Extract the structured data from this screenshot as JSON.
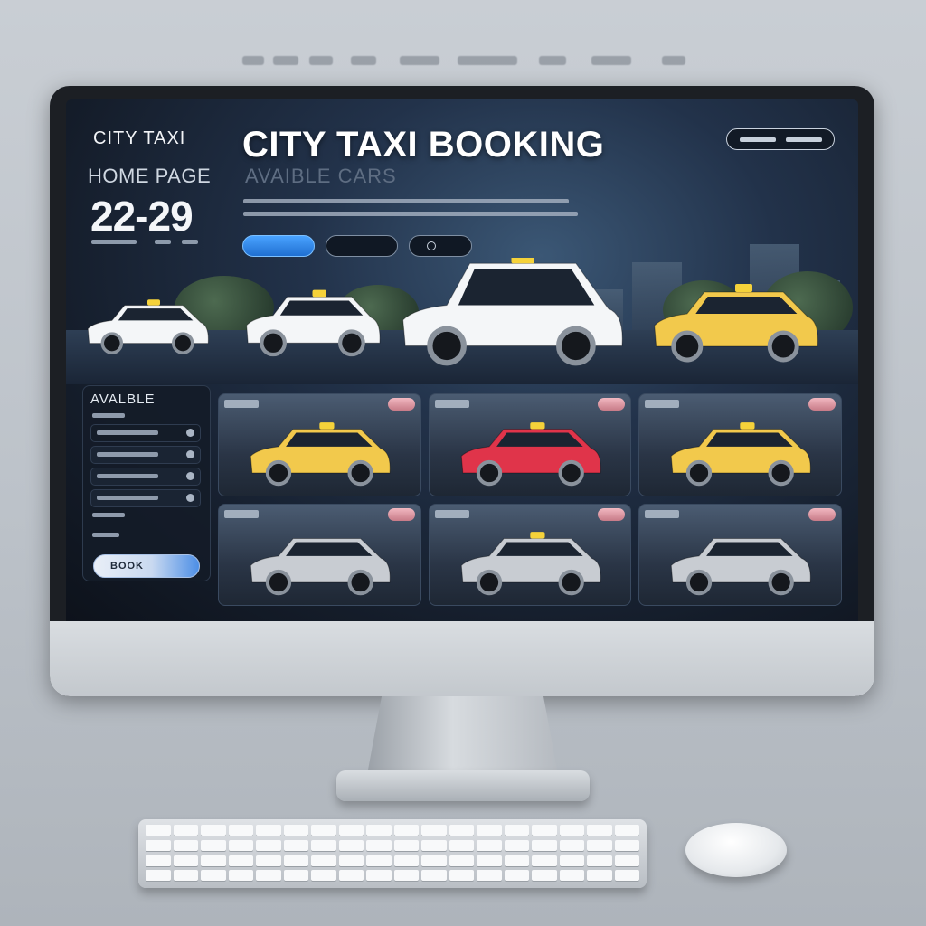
{
  "window": {
    "title": "CITY TAXI BOOKING"
  },
  "sidebar": {
    "brand": "CITY TAXI",
    "home_label": "HOME PAGE",
    "time_display": "22-29"
  },
  "header": {
    "title": "CITY TAXI BOOKING",
    "subtitle": "AVAIBLE CARS"
  },
  "available_panel": {
    "title": "AVALBLE",
    "book_button_label": "BOOK"
  },
  "icons": {
    "taxi_sign": "taxi-roof-sign-icon",
    "status_dot": "status-dot-icon"
  },
  "colors": {
    "accent": "#2f86ff",
    "taxi_yellow": "#f2c94c",
    "taxi_white": "#f4f6f8",
    "car_red": "#e0344a",
    "car_silver": "#c8ccd2",
    "screen_bg": "#141c29"
  },
  "hero_cars": [
    {
      "color": "#f4f6f8",
      "type": "suv",
      "taxi": true
    },
    {
      "color": "#f4f6f8",
      "type": "suv",
      "taxi": true
    },
    {
      "color": "#f4f6f8",
      "type": "van",
      "taxi": true
    },
    {
      "color": "#f2c94c",
      "type": "suv",
      "taxi": true
    }
  ],
  "cars": [
    {
      "color": "#f2c94c",
      "taxi": true
    },
    {
      "color": "#e0344a",
      "taxi": true
    },
    {
      "color": "#f2c94c",
      "taxi": true
    },
    {
      "color": "#c8ccd2",
      "taxi": false
    },
    {
      "color": "#c8ccd2",
      "taxi": true
    },
    {
      "color": "#c8ccd2",
      "taxi": false
    }
  ]
}
